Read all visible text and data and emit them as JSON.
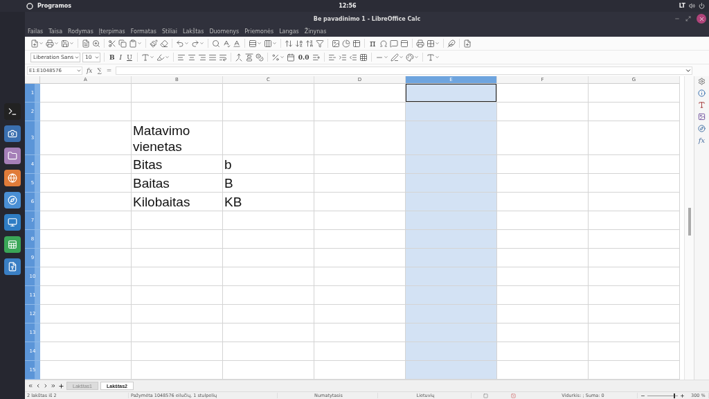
{
  "top_bar": {
    "menu": "Programos",
    "clock": "12:56",
    "keyboard_layout": "LT"
  },
  "window": {
    "title": "Be pavadinimo 1 - LibreOffice Calc"
  },
  "menu": [
    "Failas",
    "Taisa",
    "Rodymas",
    "Įterpimas",
    "Formatas",
    "Stiliai",
    "Lakštas",
    "Duomenys",
    "Priemonės",
    "Langas",
    "Žinynas"
  ],
  "toolbar_standard": [
    {
      "kind": "icon-menu"
    },
    {
      "kind": "icon-menu"
    },
    {
      "kind": "icon-menu"
    },
    {
      "kind": "separator"
    },
    {
      "kind": "icon"
    },
    {
      "kind": "icon"
    },
    {
      "kind": "separator"
    },
    {
      "kind": "icon"
    },
    {
      "kind": "icon"
    },
    {
      "kind": "icon-menu"
    },
    {
      "kind": "separator"
    },
    {
      "kind": "icon"
    },
    {
      "kind": "icon"
    },
    {
      "kind": "separator"
    },
    {
      "kind": "icon-menu"
    },
    {
      "kind": "icon-menu"
    },
    {
      "kind": "separator"
    },
    {
      "kind": "icon"
    },
    {
      "kind": "icon"
    },
    {
      "kind": "icon"
    },
    {
      "kind": "separator"
    },
    {
      "kind": "icon-menu"
    },
    {
      "kind": "icon-menu"
    },
    {
      "kind": "separator"
    },
    {
      "kind": "icon"
    },
    {
      "kind": "icon"
    },
    {
      "kind": "icon"
    },
    {
      "kind": "icon"
    },
    {
      "kind": "separator"
    },
    {
      "kind": "icon"
    },
    {
      "kind": "icon"
    },
    {
      "kind": "icon"
    },
    {
      "kind": "separator"
    },
    {
      "kind": "symbol",
      "label": "π"
    },
    {
      "kind": "icon"
    },
    {
      "kind": "icon"
    },
    {
      "kind": "icon"
    },
    {
      "kind": "separator"
    },
    {
      "kind": "icon"
    },
    {
      "kind": "icon-menu"
    },
    {
      "kind": "separator"
    },
    {
      "kind": "icon"
    },
    {
      "kind": "separator"
    },
    {
      "kind": "icon"
    }
  ],
  "toolbar_format": [
    {
      "kind": "combo",
      "value": "Liberation Sans"
    },
    {
      "kind": "combo",
      "value": "10"
    },
    {
      "kind": "separator"
    },
    {
      "kind": "bold",
      "label": "B"
    },
    {
      "kind": "italic",
      "label": "I"
    },
    {
      "kind": "underline",
      "label": "U"
    },
    {
      "kind": "separator"
    },
    {
      "kind": "icon-menu"
    },
    {
      "kind": "icon-menu"
    },
    {
      "kind": "separator"
    },
    {
      "kind": "icon"
    },
    {
      "kind": "icon"
    },
    {
      "kind": "icon"
    },
    {
      "kind": "icon"
    },
    {
      "kind": "icon"
    },
    {
      "kind": "separator"
    },
    {
      "kind": "icon"
    },
    {
      "kind": "icon"
    },
    {
      "kind": "icon"
    },
    {
      "kind": "separator"
    },
    {
      "kind": "icon-menu"
    },
    {
      "kind": "icon"
    },
    {
      "kind": "bold",
      "label": "0.0"
    },
    {
      "kind": "icon"
    },
    {
      "kind": "separator"
    },
    {
      "kind": "icon"
    },
    {
      "kind": "icon"
    },
    {
      "kind": "icon"
    },
    {
      "kind": "icon"
    },
    {
      "kind": "separator"
    },
    {
      "kind": "icon-menu"
    },
    {
      "kind": "icon-menu"
    },
    {
      "kind": "icon-menu"
    },
    {
      "kind": "separator"
    },
    {
      "kind": "icon-menu"
    }
  ],
  "formula_bar": {
    "name_box": "E1:E1048576",
    "function_wizard": "fx",
    "sum": "∑",
    "equals": "="
  },
  "sidebar": {
    "functions": "fx"
  },
  "columns": [
    {
      "label": "A",
      "selected": false
    },
    {
      "label": "B",
      "selected": false
    },
    {
      "label": "C",
      "selected": false
    },
    {
      "label": "D",
      "selected": false
    },
    {
      "label": "E",
      "selected": true
    },
    {
      "label": "F",
      "selected": false
    },
    {
      "label": "G",
      "selected": false
    }
  ],
  "rows": [
    {
      "label": "1",
      "selected": true,
      "cursor": true
    },
    {
      "label": "2",
      "selected": true,
      "cursor": false
    },
    {
      "label": "3",
      "selected": true,
      "cursor": false,
      "cells": {
        "B": "Matavimo vienetas"
      }
    },
    {
      "label": "4",
      "selected": true,
      "cursor": false,
      "cells": {
        "B": "Bitas",
        "C": "b"
      }
    },
    {
      "label": "5",
      "selected": true,
      "cursor": false,
      "cells": {
        "B": "Baitas",
        "C": "B"
      }
    },
    {
      "label": "6",
      "selected": true,
      "cursor": false,
      "cells": {
        "B": "Kilobaitas",
        "C": "KB"
      }
    },
    {
      "label": "7",
      "selected": true,
      "cursor": false
    },
    {
      "label": "8",
      "selected": true,
      "cursor": false
    },
    {
      "label": "9",
      "selected": true,
      "cursor": false
    },
    {
      "label": "10",
      "selected": true,
      "cursor": false
    },
    {
      "label": "11",
      "selected": true,
      "cursor": false
    },
    {
      "label": "12",
      "selected": true,
      "cursor": false
    },
    {
      "label": "13",
      "selected": true,
      "cursor": false
    },
    {
      "label": "14",
      "selected": true,
      "cursor": false
    },
    {
      "label": "15",
      "selected": true,
      "cursor": false
    }
  ],
  "sheet_tabs": [
    {
      "label": "Lakštas1",
      "selected": false
    },
    {
      "label": "Lakštas2",
      "selected": true
    }
  ],
  "status_bar": {
    "sheet": "2 lakštas iš 2",
    "selection": "Pažymėta 1048576 eilučių, 1 stulpelių",
    "page_style": "Numatytasis",
    "language": "Lietuvių",
    "summary": "Vidurkis: ; Suma: 0",
    "zoom": {
      "level": 0.86
    },
    "zoom_percent": "300 %"
  }
}
